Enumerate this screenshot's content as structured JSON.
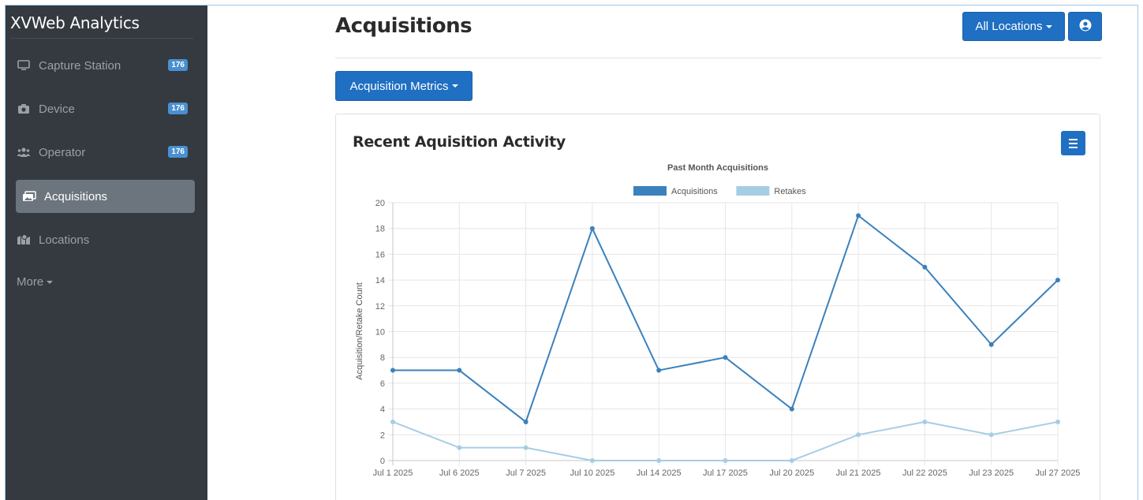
{
  "app": {
    "brand": "XVWeb Analytics"
  },
  "sidebar": {
    "items": [
      {
        "label": "Capture Station",
        "badge": "176",
        "icon": "monitor-icon"
      },
      {
        "label": "Device",
        "badge": "176",
        "icon": "camera-icon"
      },
      {
        "label": "Operator",
        "badge": "176",
        "icon": "users-icon"
      },
      {
        "label": "Acquisitions",
        "badge": "",
        "icon": "images-icon",
        "active": true
      },
      {
        "label": "Locations",
        "badge": "",
        "icon": "map-icon"
      }
    ],
    "more_label": "More"
  },
  "header": {
    "title": "Acquisitions",
    "locations_button": "All Locations",
    "user_icon": "user-circle-icon"
  },
  "metrics_button": "Acquisition Metrics",
  "card": {
    "title": "Recent Aquisition Activity",
    "menu_icon": "hamburger-icon"
  },
  "colors": {
    "primary": "#1f6fc2",
    "sidebar_bg": "#343a40",
    "acquisitions": "#3a81bd",
    "retakes": "#a6cde4",
    "badge": "#4a90d0"
  },
  "chart_data": {
    "type": "line",
    "title": "Past Month Acquisitions",
    "ylabel": "Acquisition/Retake Count",
    "xlabel": "",
    "categories": [
      "Jul 1 2025",
      "Jul 6 2025",
      "Jul 7 2025",
      "Jul 10 2025",
      "Jul 14 2025",
      "Jul 17 2025",
      "Jul 20 2025",
      "Jul 21 2025",
      "Jul 22 2025",
      "Jul 23 2025",
      "Jul 27 2025"
    ],
    "series": [
      {
        "name": "Acquisitions",
        "values": [
          7,
          7,
          3,
          18,
          7,
          8,
          4,
          19,
          15,
          9,
          14
        ],
        "color": "#3a81bd"
      },
      {
        "name": "Retakes",
        "values": [
          3,
          1,
          1,
          0,
          0,
          0,
          0,
          2,
          3,
          2,
          3
        ],
        "color": "#a6cde4"
      }
    ],
    "ylim": [
      0,
      20
    ],
    "yticks": [
      0,
      2,
      4,
      6,
      8,
      10,
      12,
      14,
      16,
      18,
      20
    ],
    "grid": true,
    "legend": "top"
  }
}
